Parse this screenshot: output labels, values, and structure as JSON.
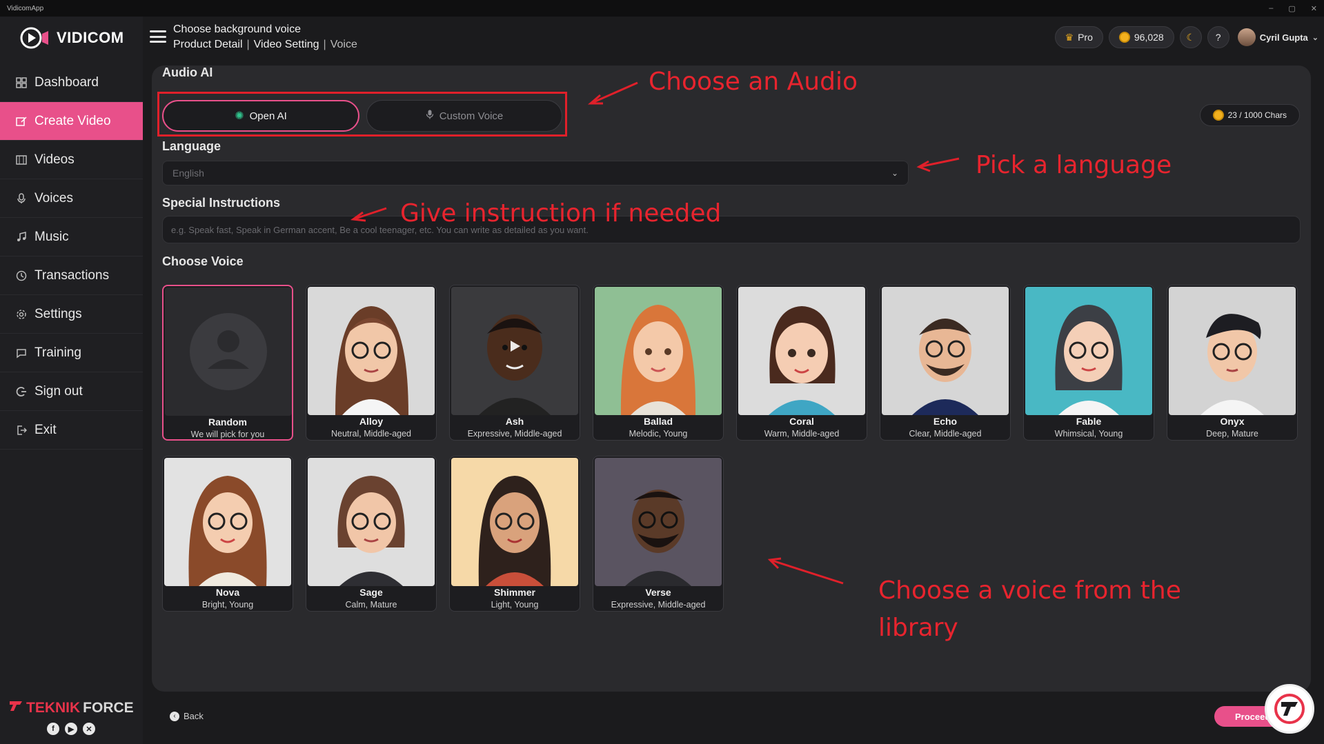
{
  "window": {
    "title": "VidicomApp",
    "controls": [
      "–",
      "▢",
      "✕"
    ]
  },
  "brand": {
    "name": "VIDICOM"
  },
  "sidebar": {
    "items": [
      {
        "label": "Dashboard",
        "icon": "grid-icon"
      },
      {
        "label": "Create Video",
        "icon": "edit-icon",
        "active": true
      },
      {
        "label": "Videos",
        "icon": "film-icon"
      },
      {
        "label": "Voices",
        "icon": "microphone-icon"
      },
      {
        "label": "Music",
        "icon": "music-icon"
      },
      {
        "label": "Transactions",
        "icon": "history-icon"
      },
      {
        "label": "Settings",
        "icon": "gear-icon"
      },
      {
        "label": "Training",
        "icon": "chat-icon"
      },
      {
        "label": "Sign out",
        "icon": "logout-icon"
      },
      {
        "label": "Exit",
        "icon": "exit-icon"
      }
    ],
    "footer_brand": {
      "part1": "TEKNIK",
      "part2": "FORCE"
    }
  },
  "header": {
    "title": "Choose background voice",
    "breadcrumbs": [
      "Product Detail",
      "Video Setting",
      "Voice"
    ],
    "plan": "Pro",
    "credits": "96,028",
    "user_name": "Cyril Gupta"
  },
  "audio": {
    "section_label": "Audio AI",
    "tabs": [
      {
        "label": "Open AI",
        "active": true
      },
      {
        "label": "Custom Voice",
        "active": false
      }
    ],
    "chars": "23 / 1000 Chars"
  },
  "language": {
    "label": "Language",
    "value": "English"
  },
  "instructions": {
    "label": "Special Instructions",
    "placeholder": "e.g. Speak fast, Speak in German accent, Be a cool teenager, etc. You can write as detailed as you want."
  },
  "voices": {
    "label": "Choose Voice",
    "items": [
      {
        "name": "Random",
        "desc": "We will pick for you",
        "selected": true,
        "bg": "#2b2b2e"
      },
      {
        "name": "Alloy",
        "desc": "Neutral, Middle-aged",
        "bg": "#d9d9d9"
      },
      {
        "name": "Ash",
        "desc": "Expressive, Middle-aged",
        "bg": "#3a3a3d"
      },
      {
        "name": "Ballad",
        "desc": "Melodic, Young",
        "bg": "#8fbf94"
      },
      {
        "name": "Coral",
        "desc": "Warm, Middle-aged",
        "bg": "#dcdcdc"
      },
      {
        "name": "Echo",
        "desc": "Clear, Middle-aged",
        "bg": "#d6d6d6"
      },
      {
        "name": "Fable",
        "desc": "Whimsical, Young",
        "bg": "#49b8c4"
      },
      {
        "name": "Onyx",
        "desc": "Deep, Mature",
        "bg": "#d3d3d3"
      },
      {
        "name": "Nova",
        "desc": "Bright, Young",
        "bg": "#e2e2e2"
      },
      {
        "name": "Sage",
        "desc": "Calm, Mature",
        "bg": "#dedede"
      },
      {
        "name": "Shimmer",
        "desc": "Light, Young",
        "bg": "#f6d9a8"
      },
      {
        "name": "Verse",
        "desc": "Expressive, Middle-aged",
        "bg": "#5a5461"
      }
    ]
  },
  "annotations": {
    "audio": "Choose an Audio",
    "language": "Pick a language",
    "instruction": "Give instruction if needed",
    "voice_line1": "Choose a voice from the",
    "voice_line2": "library"
  },
  "footer": {
    "back": "Back",
    "proceed": "Proceed"
  },
  "colors": {
    "accent": "#e8508a",
    "annotation": "#e0202a",
    "coin": "#f2b01e",
    "openai": "#31c58e"
  }
}
